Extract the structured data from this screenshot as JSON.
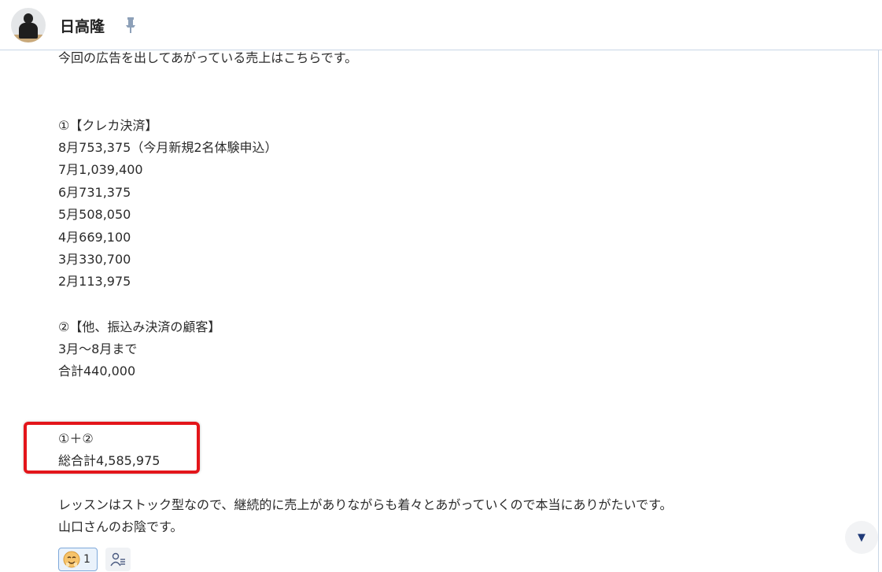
{
  "header": {
    "name": "日高隆",
    "avatar_icon": "user-avatar-photo",
    "pin_icon": "pin-icon"
  },
  "message": {
    "lines": [
      "今回の広告を出してあがっている売上はこちらです。",
      "",
      "",
      "①【クレカ決済】",
      "8月753,375（今月新規2名体験申込）",
      "7月1,039,400",
      "6月731,375",
      "5月508,050",
      "4月669,100",
      "3月330,700",
      "2月113,975",
      "",
      "②【他、振込み決済の顧客】",
      "3月〜8月まで",
      "合計440,000",
      "",
      "",
      "①＋②",
      "総合計4,585,975",
      "",
      "レッスンはストック型なので、継続的に売上がありながらも着々とあがっていくので本当にありがたいです。",
      "山口さんのお陰です。"
    ],
    "highlight_color": "#e3151a"
  },
  "reactions": {
    "count": "1",
    "emoji_icon": "thankful-face-icon",
    "read_icon": "read-users-icon"
  },
  "scroll": {
    "icon": "scroll-down-icon"
  }
}
